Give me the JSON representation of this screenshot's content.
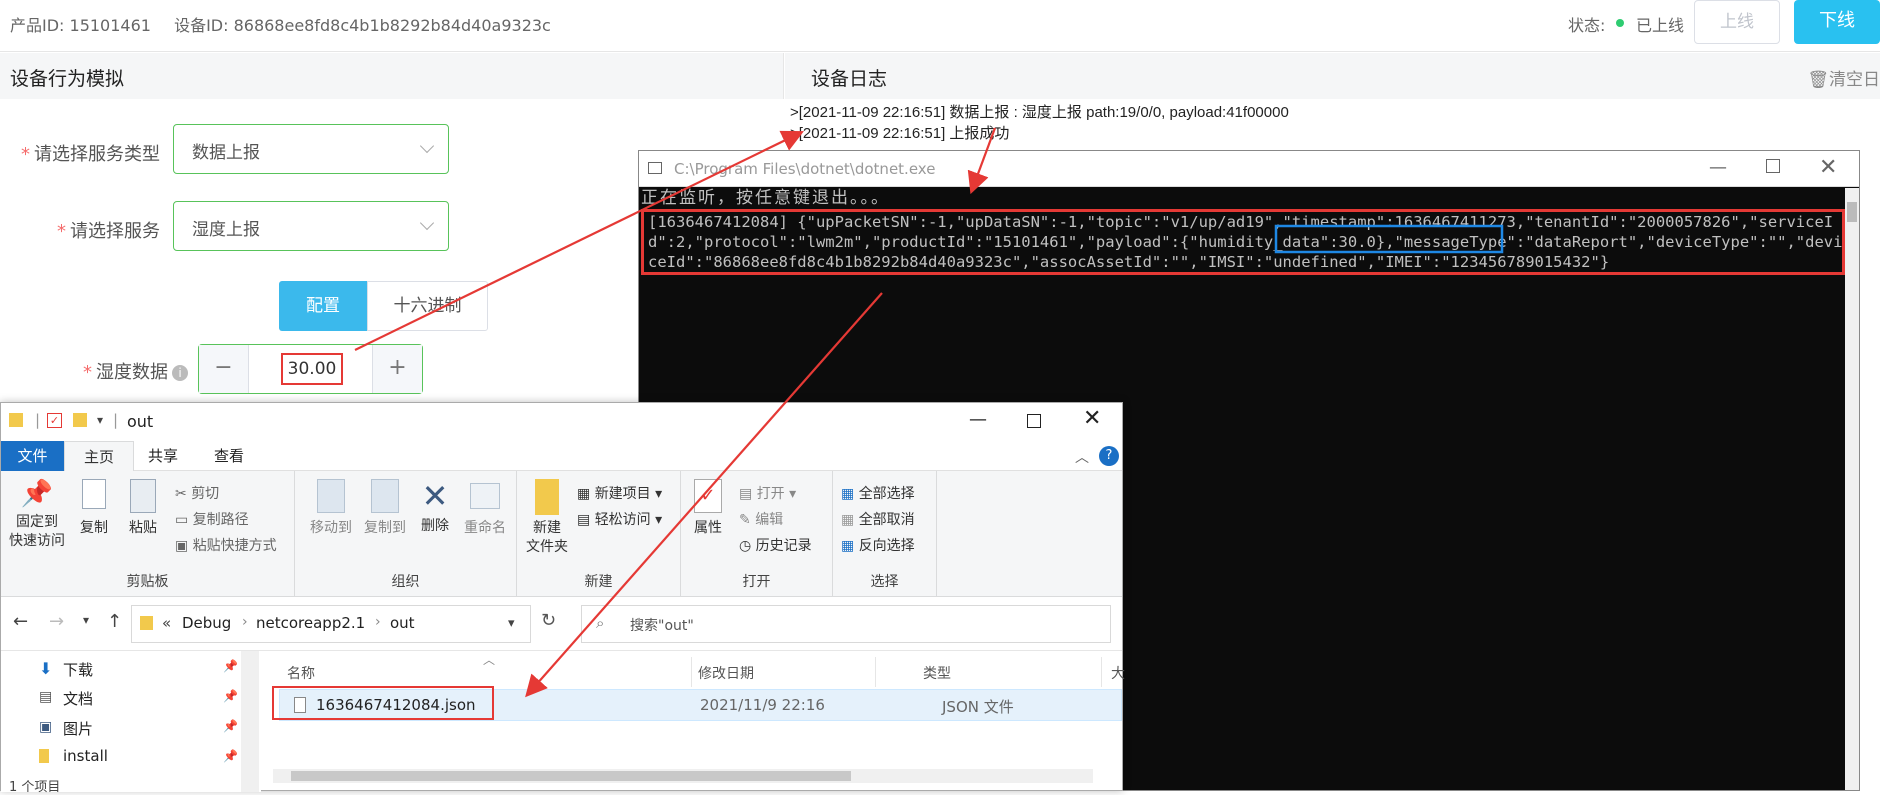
{
  "topbar": {
    "product_id": "产品ID: 15101461",
    "device_id": "设备ID: 86868ee8fd8c4b1b8292b84d40a9323c",
    "status_label": "状态:",
    "status_text": "已上线",
    "online_button": "上线",
    "offline_button": "下线",
    "status_color": "#2ecc71",
    "accent": "#29c1f0"
  },
  "simulator": {
    "title": "设备行为模拟",
    "service_type_label": "请选择服务类型",
    "service_type_value": "数据上报",
    "service_label": "请选择服务",
    "service_value": "湿度上报",
    "tab_config": "配置",
    "tab_hex": "十六进制",
    "humidity_label": "湿度数据",
    "humidity_value": "30.00",
    "minus": "−",
    "plus": "+"
  },
  "device_log": {
    "title": "设备日志",
    "clear": "清空日",
    "lines": [
      ">[2021-11-09 22:16:51] 数据上报 : 湿度上报  path:19/0/0, payload:41f00000",
      ">[2021-11-09 22:16:51] 上报成功"
    ]
  },
  "console": {
    "title": "C:\\Program Files\\dotnet\\dotnet.exe",
    "line1": "正在监听，按任意键退出。。。",
    "json_text": "[1636467412084] {\"upPacketSN\":-1,\"upDataSN\":-1,\"topic\":\"v1/up/ad19\",\"timestamp\":1636467411273,\"tenantId\":\"2000057826\",\"serviceId\":2,\"protocol\":\"lwm2m\",\"productId\":\"15101461\",\"payload\":{\"humidity_data\":30.0},\"messageType\":\"dataReport\",\"deviceType\":\"\",\"deviceId\":\"86868ee8fd8c4b1b8292b84d40a9323c\",\"assocAssetId\":\"\",\"IMSI\":\"undefined\",\"IMEI\":\"123456789015432\"}",
    "highlight": "{\"humidity_data\":30.0}"
  },
  "explorer": {
    "title": "out",
    "tabs": [
      "文件",
      "主页",
      "共享",
      "查看"
    ],
    "groups": {
      "clipboard": "剪贴板",
      "organize": "组织",
      "new": "新建",
      "open": "打开",
      "select": "选择"
    },
    "buttons": {
      "pin": "固定到\n快速访问",
      "copy": "复制",
      "paste": "粘贴",
      "cut": "剪切",
      "copy_path": "复制路径",
      "paste_shortcut": "粘贴快捷方式",
      "move_to": "移动到",
      "copy_to": "复制到",
      "delete": "删除",
      "rename": "重命名",
      "new_item": "新建项目",
      "easy_access": "轻松访问",
      "new_folder": "新建\n文件夹",
      "properties": "属性",
      "open": "打开",
      "edit": "编辑",
      "history": "历史记录",
      "select_all": "全部选择",
      "select_none": "全部取消",
      "invert": "反向选择"
    },
    "breadcrumb": [
      "«",
      "Debug",
      "netcoreapp2.1",
      "out"
    ],
    "search_placeholder": "搜索\"out\"",
    "nav": [
      "下载",
      "文档",
      "图片",
      "install"
    ],
    "columns": [
      "名称",
      "修改日期",
      "类型",
      "大"
    ],
    "file": {
      "name": "1636467412084.json",
      "date": "2021/11/9 22:16",
      "type": "JSON 文件"
    },
    "status": "1 个项目"
  }
}
